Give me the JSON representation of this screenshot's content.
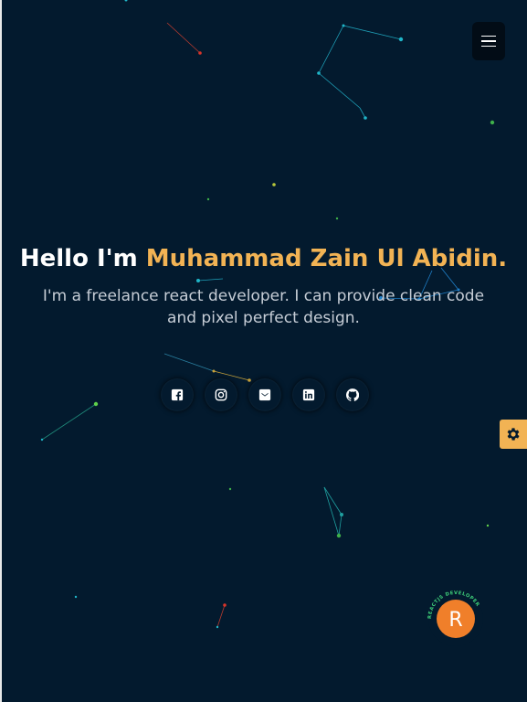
{
  "header": {
    "menu_icon": "hamburger-icon"
  },
  "hero": {
    "greeting": "Hello I'm ",
    "name": "Muhammad Zain Ul Abidin.",
    "description": "I'm a freelance react developer. I can provide clean code and pixel perfect design."
  },
  "socials": [
    {
      "name": "facebook",
      "icon": "facebook-icon"
    },
    {
      "name": "instagram",
      "icon": "instagram-icon"
    },
    {
      "name": "twitter",
      "icon": "twitter-icon"
    },
    {
      "name": "linkedin",
      "icon": "linkedin-icon"
    },
    {
      "name": "github",
      "icon": "github-icon"
    }
  ],
  "settings": {
    "icon": "gear-icon"
  },
  "badge": {
    "letter": "R",
    "ring_text": "REACTJS DEVELOPER"
  },
  "colors": {
    "background": "#031a2e",
    "accent": "#f2b354",
    "badge": "#f07f2a",
    "particle_cyan": "#1fb5c8",
    "particle_green": "#5fd04a",
    "particle_red": "#d8342a"
  }
}
